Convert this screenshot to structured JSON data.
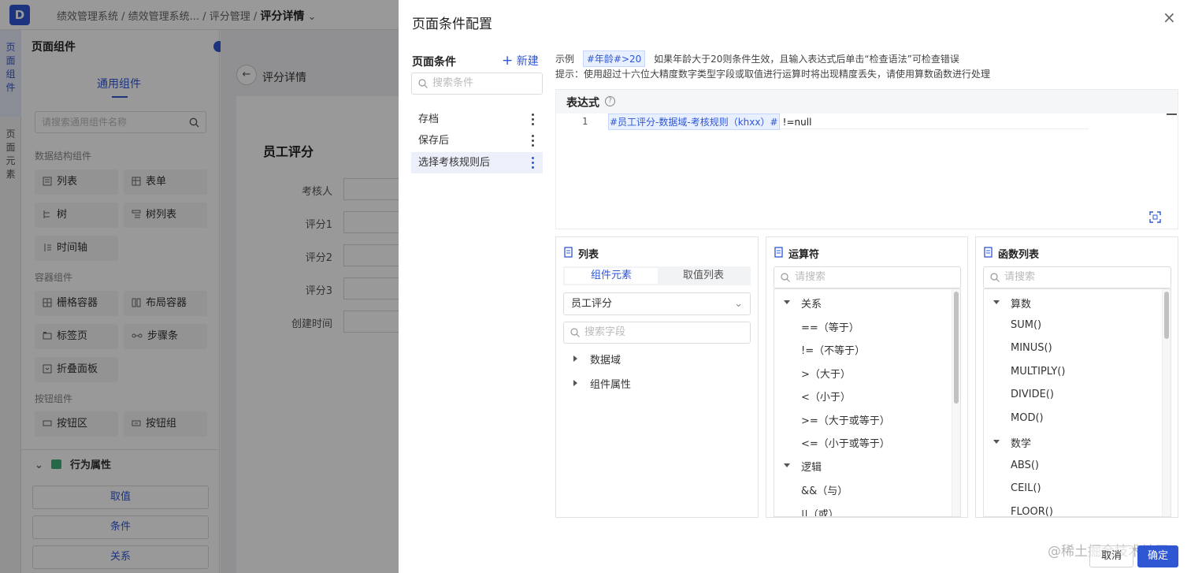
{
  "app": {
    "logo": "D",
    "breadcrumb": [
      "绩效管理系统",
      "绩效管理系统...",
      "评分管理"
    ],
    "current": "评分详情"
  },
  "vtabs": [
    "页面组件",
    "页面元素"
  ],
  "components": {
    "title": "页面组件",
    "tab": "通用组件",
    "search_placeholder": "请搜索通用组件名称",
    "sections": [
      {
        "title": "数据结构组件",
        "items": [
          "列表",
          "表单",
          "树",
          "树列表",
          "时间轴"
        ]
      },
      {
        "title": "容器组件",
        "items": [
          "栅格容器",
          "布局容器",
          "标签页",
          "步骤条",
          "折叠面板"
        ]
      },
      {
        "title": "按钮组件",
        "items": [
          "按钮区",
          "按钮组"
        ]
      }
    ],
    "behavior_title": "行为属性",
    "behavior_buttons": [
      "取值",
      "条件",
      "关系"
    ]
  },
  "stage": {
    "page_title": "评分详情",
    "form_title": "员工评分",
    "fields": [
      "考核人",
      "评分1",
      "评分2",
      "评分3",
      "创建时间"
    ]
  },
  "drawer": {
    "title": "页面条件配置",
    "close": "×",
    "conditions_title": "页面条件",
    "new_label": "新建",
    "search_placeholder": "搜索条件",
    "conditions": [
      "存档",
      "保存后",
      "选择考核规则后"
    ],
    "selected_condition": 2,
    "example_label": "示例",
    "example_tag": "#年龄#>20",
    "example_desc": "如果年龄大于20则条件生效，且输入表达式后单击“检查语法”可检查错误",
    "hint": "提示：使用超过十六位大精度数字类型字段或取值进行运算时将出现精度丢失，请使用算数函数进行处理",
    "expr_title": "表达式",
    "expr_help": "?",
    "editor": {
      "line_no": "1",
      "token": "#员工评分-数据域-考核规则（khxx）#",
      "rest": "!=null"
    },
    "list_panel": {
      "title": "列表",
      "tabs": [
        "组件元素",
        "取值列表"
      ],
      "select_value": "员工评分",
      "search_placeholder": "搜索字段",
      "nodes": [
        "数据域",
        "组件属性"
      ]
    },
    "op_panel": {
      "title": "运算符",
      "search_placeholder": "请搜索",
      "groups": [
        {
          "name": "关系",
          "items": [
            "==（等于）",
            "!=（不等于）",
            ">（大于）",
            "<（小于）",
            ">=（大于或等于）",
            "<=（小于或等于）"
          ]
        },
        {
          "name": "逻辑",
          "items": [
            "&&（与）",
            "||（或）"
          ]
        }
      ]
    },
    "fn_panel": {
      "title": "函数列表",
      "search_placeholder": "请搜索",
      "groups": [
        {
          "name": "算数",
          "items": [
            "SUM()",
            "MINUS()",
            "MULTIPLY()",
            "DIVIDE()",
            "MOD()"
          ]
        },
        {
          "name": "数学",
          "items": [
            "ABS()",
            "CEIL()",
            "FLOOR()"
          ]
        }
      ]
    },
    "cancel": "取消",
    "ok": "确定",
    "watermark": "@稀土掘金技术社区"
  },
  "colors": {
    "accent": "#2f57d4",
    "token_bg": "#e8efff",
    "mask": "rgba(0,0,0,0.4)"
  }
}
